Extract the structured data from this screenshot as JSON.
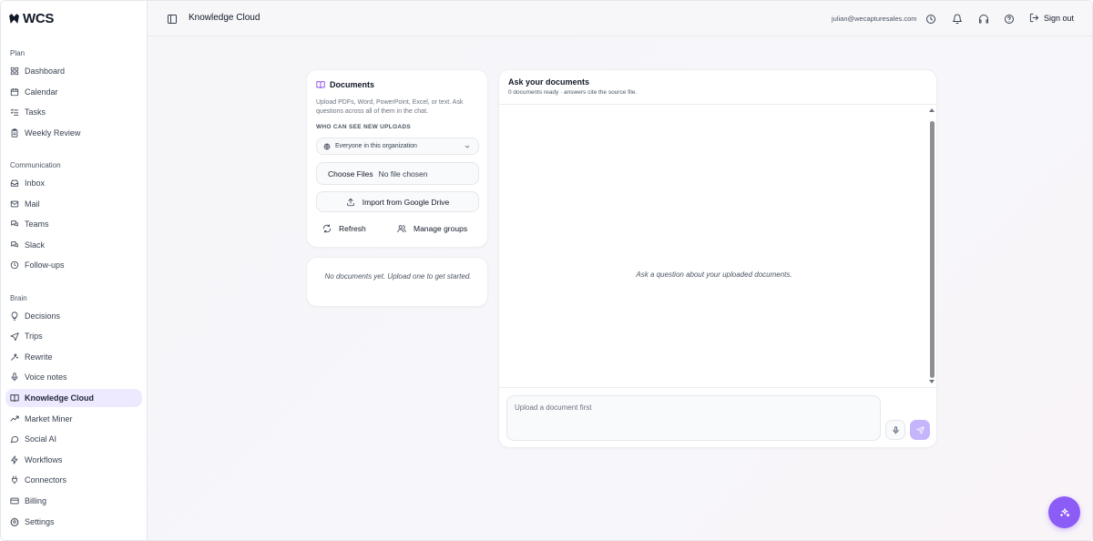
{
  "brand": {
    "name": "WCS"
  },
  "sidebar": {
    "sections": [
      {
        "label": "Plan"
      },
      {
        "label": "Communication"
      },
      {
        "label": "Brain"
      }
    ],
    "items": [
      {
        "label": "Dashboard",
        "icon": "grid-icon"
      },
      {
        "label": "Calendar",
        "icon": "calendar-icon"
      },
      {
        "label": "Tasks",
        "icon": "checklist-icon"
      },
      {
        "label": "Weekly Review",
        "icon": "clipboard-icon"
      },
      {
        "label": "Inbox",
        "icon": "inbox-icon"
      },
      {
        "label": "Mail",
        "icon": "mail-icon"
      },
      {
        "label": "Teams",
        "icon": "chat-icon"
      },
      {
        "label": "Slack",
        "icon": "chat-icon"
      },
      {
        "label": "Follow-ups",
        "icon": "clock-icon"
      },
      {
        "label": "Decisions",
        "icon": "lightbulb-icon"
      },
      {
        "label": "Trips",
        "icon": "plane-icon"
      },
      {
        "label": "Rewrite",
        "icon": "wand-icon"
      },
      {
        "label": "Voice notes",
        "icon": "mic-icon"
      },
      {
        "label": "Knowledge Cloud",
        "icon": "book-icon",
        "active": true
      },
      {
        "label": "Market Miner",
        "icon": "trend-icon"
      },
      {
        "label": "Social AI",
        "icon": "message-icon"
      },
      {
        "label": "Workflows",
        "icon": "bolt-icon"
      },
      {
        "label": "Connectors",
        "icon": "plug-icon"
      },
      {
        "label": "Billing",
        "icon": "card-icon"
      },
      {
        "label": "Settings",
        "icon": "gear-icon"
      }
    ]
  },
  "topbar": {
    "title": "Knowledge Cloud",
    "email": "julian@wecapturesales.com",
    "signout_label": "Sign out"
  },
  "documents": {
    "title": "Documents",
    "description": "Upload PDFs, Word, PowerPoint, Excel, or text. Ask questions across all of them in the chat.",
    "visibility_label": "WHO CAN SEE NEW UPLOADS",
    "visibility_value": "Everyone in this organization",
    "file_button": "Choose Files",
    "file_status": "No file chosen",
    "import_label": "Import from Google Drive",
    "refresh_label": "Refresh",
    "manage_label": "Manage groups",
    "empty_text": "No documents yet. Upload one to get started."
  },
  "chat": {
    "title": "Ask your documents",
    "subtitle": "0 documents ready · answers cite the source file.",
    "empty_text": "Ask a question about your uploaded documents.",
    "input_placeholder": "Upload a document first"
  },
  "colors": {
    "accent": "#8b5cf6",
    "active_bg": "#ede9fe",
    "send_disabled": "#c4b5fd"
  }
}
